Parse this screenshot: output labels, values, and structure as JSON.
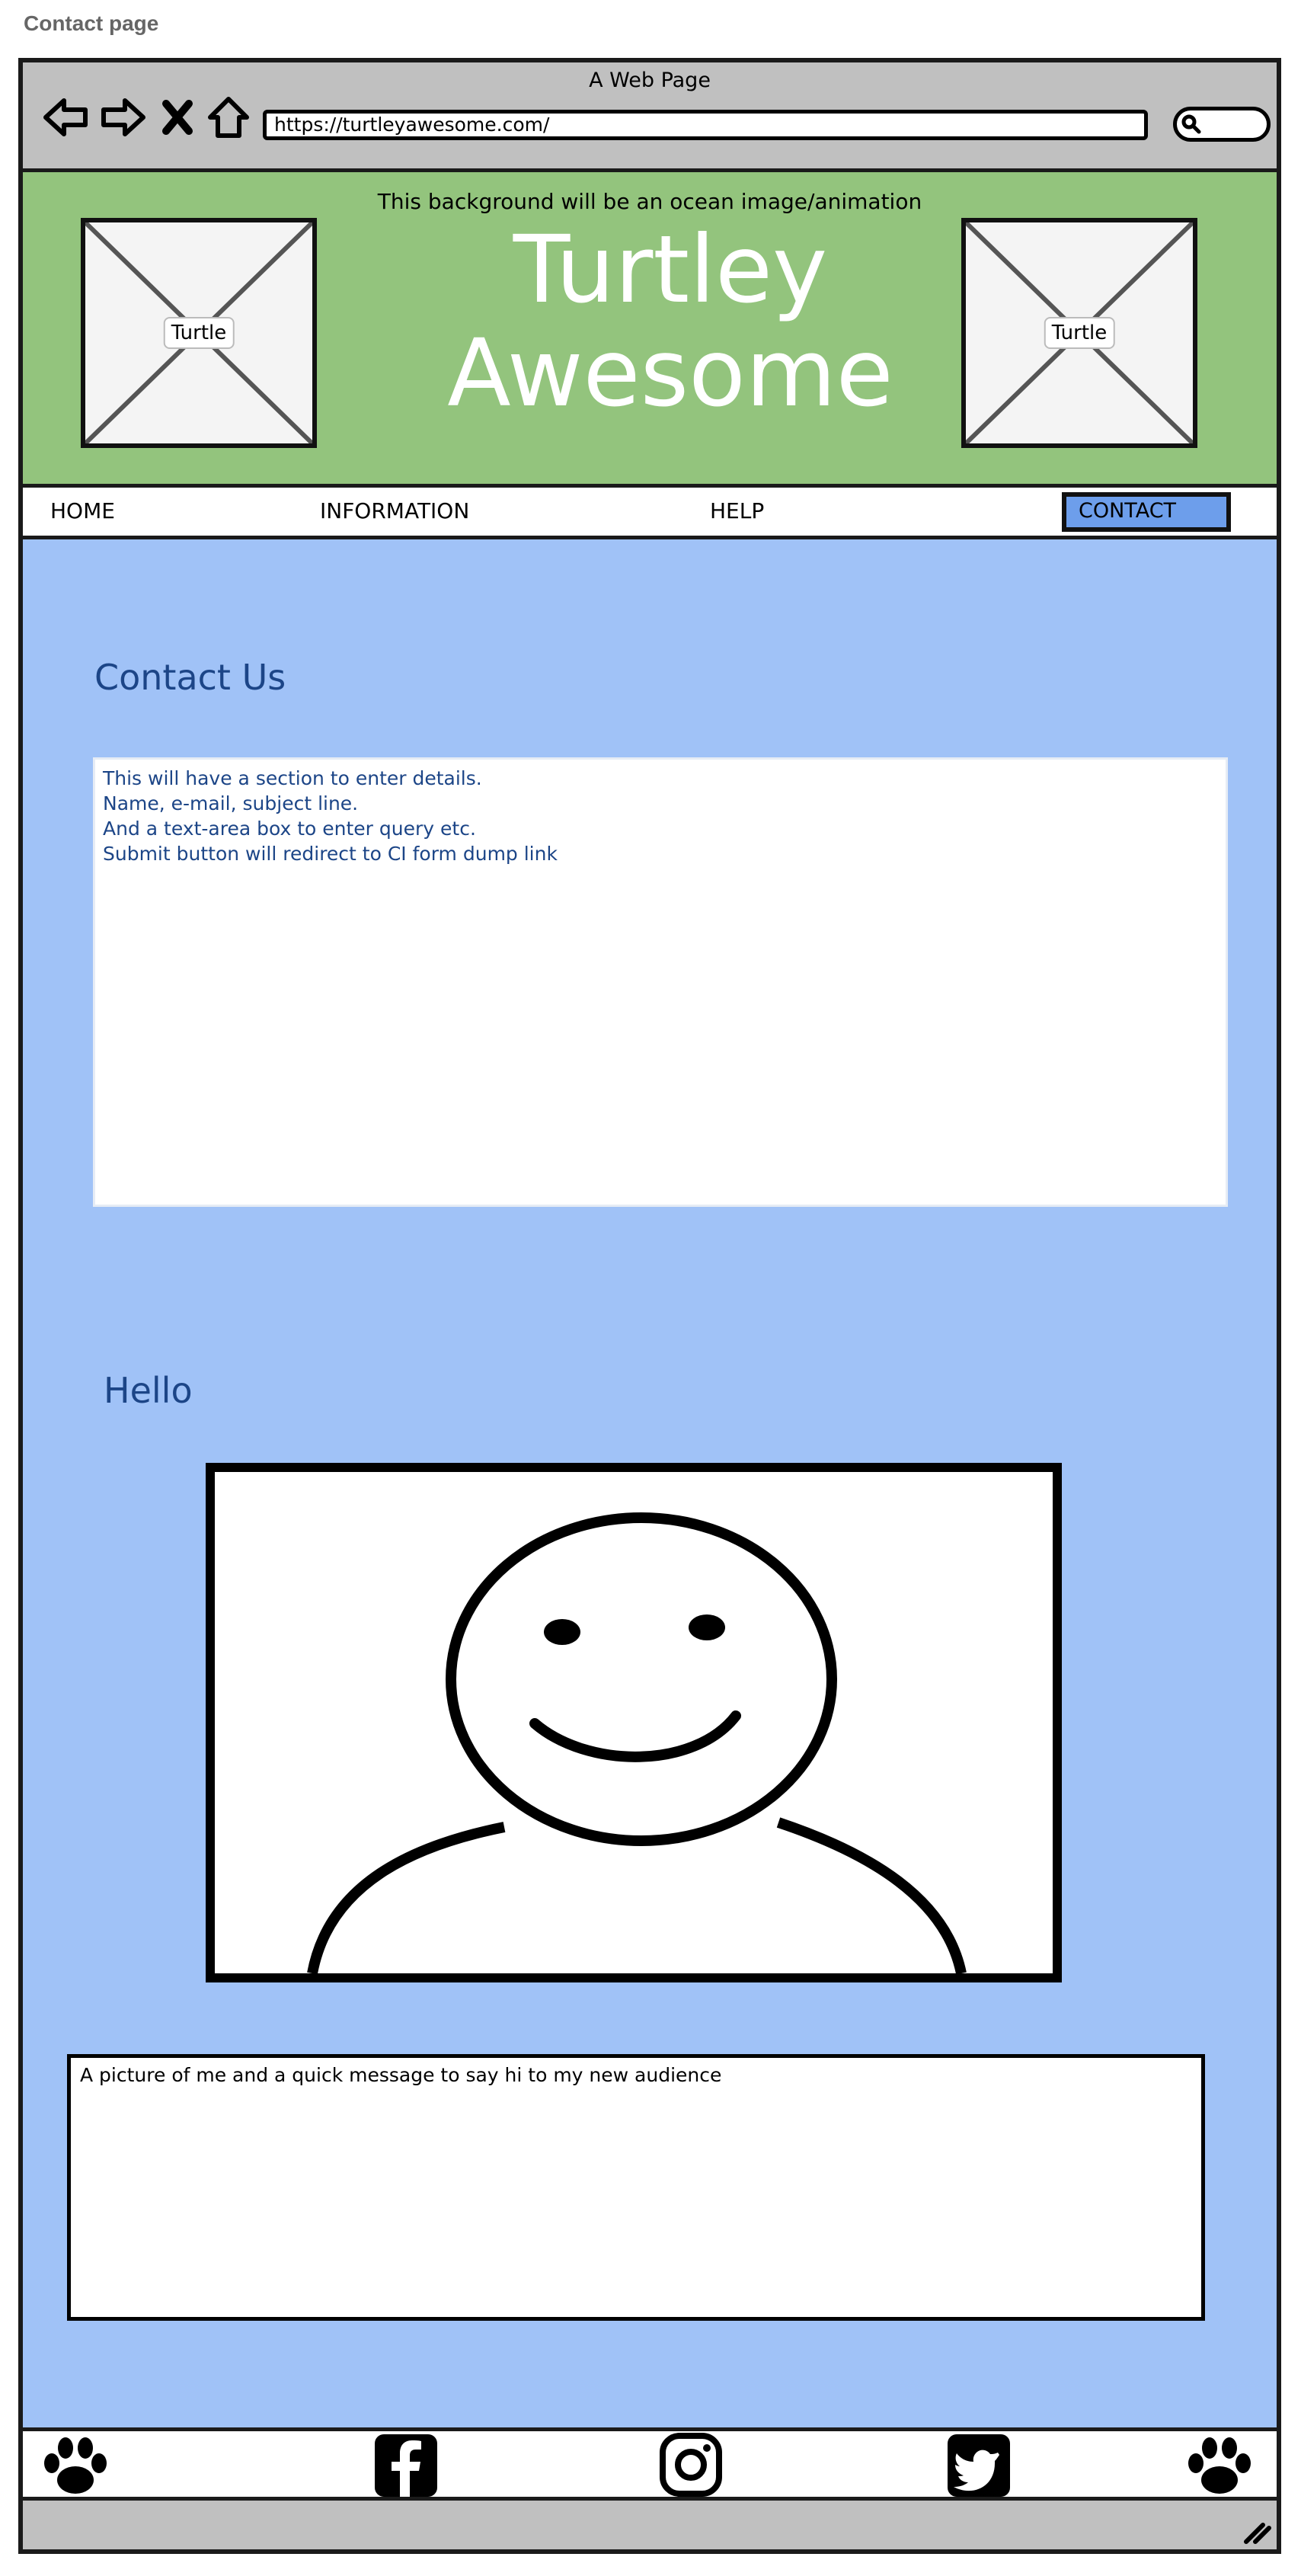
{
  "page_label": "Contact page",
  "browser": {
    "title": "A Web Page",
    "url": "https://turtleyawesome.com/"
  },
  "header": {
    "background_note": "This background will be an ocean image/animation",
    "title_line1": "Turtley",
    "title_line2": "Awesome",
    "image_left_label": "Turtle",
    "image_right_label": "Turtle"
  },
  "nav": {
    "home": "HOME",
    "information": "INFORMATION",
    "help": "HELP",
    "contact": "CONTACT"
  },
  "contact": {
    "heading": "Contact Us",
    "lines": [
      "This will have a section to enter details.",
      "Name, e-mail, subject line.",
      "And a text-area box to enter query etc.",
      "Submit button will redirect to CI form dump link"
    ]
  },
  "hello": {
    "heading": "Hello",
    "message": "A picture of me and a quick message to say hi to my new audience"
  },
  "footer": {
    "icons": [
      "paw-icon",
      "facebook-icon",
      "instagram-icon",
      "twitter-icon",
      "paw-icon"
    ]
  },
  "colors": {
    "header_green": "#93c47d",
    "content_blue": "#a0c2f7",
    "heading_blue": "#1c4587",
    "nav_active": "#6d9eeb",
    "chrome_gray": "#c0c0c0"
  }
}
